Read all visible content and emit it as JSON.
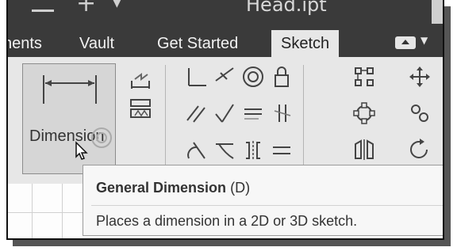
{
  "window": {
    "title": "Head.ipt"
  },
  "tabs": [
    {
      "label": "nents",
      "active": false
    },
    {
      "label": "Vault",
      "active": false
    },
    {
      "label": "Get Started",
      "active": false
    },
    {
      "label": "Sketch",
      "active": true
    }
  ],
  "ribbon": {
    "dimension_button": {
      "label": "Dimension",
      "icon": "dimension-icon"
    },
    "icons": [
      "line-dimension-icon",
      "auto-dimension-icon",
      "perpendicular-icon",
      "tangent-icon",
      "concentric-icon",
      "lock-icon",
      "parallel-icon",
      "perpendicular2-icon",
      "horizontal-icon",
      "collinear-icon",
      "smooth-icon",
      "tangent2-icon",
      "symmetric-icon",
      "equal-icon",
      "rectangle-array-icon",
      "move-icon",
      "circular-array-icon",
      "copy-icon",
      "mirror-icon",
      "rotate-icon"
    ]
  },
  "tooltip": {
    "title": "General Dimension",
    "shortcut": "(D)",
    "description": "Places a dimension in a 2D or 3D sketch."
  },
  "colors": {
    "title_bar": "#3a3a3a",
    "ribbon": "#e7e7e7",
    "active_tab": "#e7e7e7",
    "tooltip_bg": "#f7f7f7"
  }
}
